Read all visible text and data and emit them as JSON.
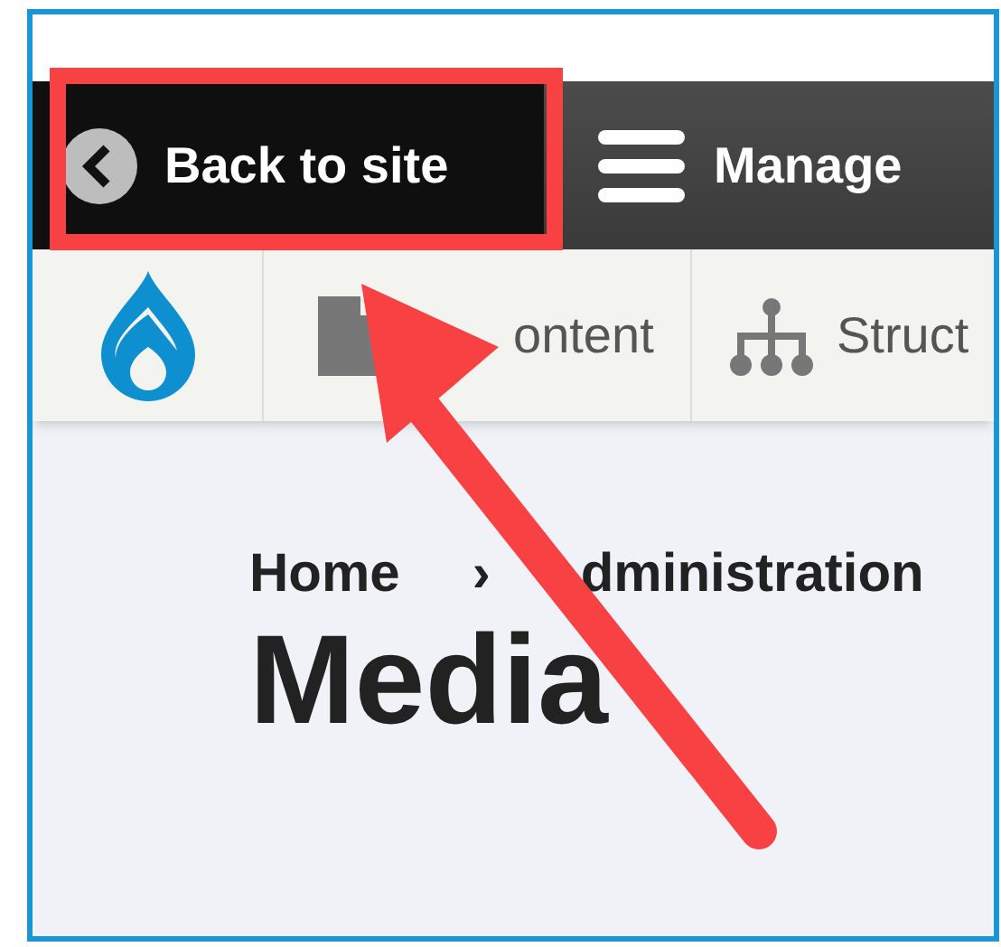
{
  "toolbar": {
    "back_link": "Back to site",
    "manage": "Manage"
  },
  "tray": [
    {
      "label": "ontent",
      "kind": "page"
    },
    {
      "label": "Struct",
      "kind": "tree"
    }
  ],
  "breadcrumb": [
    "Home",
    "›",
    "dministration"
  ],
  "page_title": "Media"
}
